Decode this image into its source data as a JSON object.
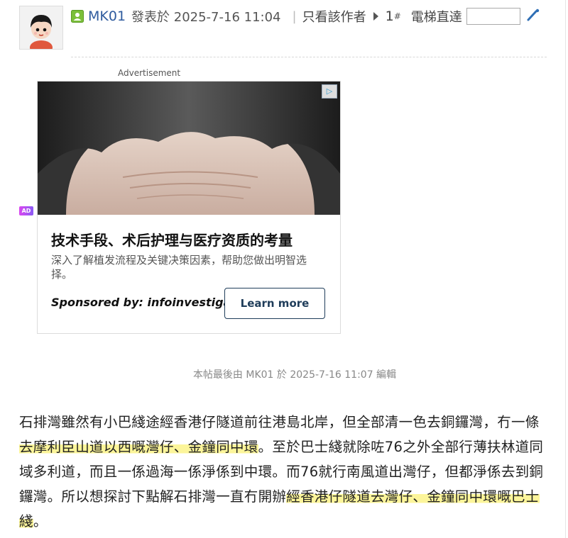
{
  "post": {
    "author": "MK01",
    "posted_text": "發表於 2025-7-16 11:04",
    "only_author_label": "只看該作者",
    "floor_number": "1",
    "floor_suffix": "#",
    "jump_label": "電梯直達",
    "jump_placeholder": ""
  },
  "ad": {
    "label": "Advertisement",
    "badge": "AD",
    "title": "技术手段、术后护理与医疗资质的考量",
    "description": "深入了解植发流程及关键决策因素，帮助您做出明智选择。",
    "sponsor": "Sponsored by: infoinvestigator",
    "cta": "Learn more"
  },
  "edit_note": "本帖最後由 MK01 於 2025-7-16 11:07 編輯",
  "body": {
    "p1": "石排灣雖然有小巴綫途經香港仔隧道前往港島北岸，但全部清一色去銅鑼灣，冇一條",
    "h1": "去摩利臣山道以西嘅灣仔、金鐘同中環",
    "p2": "。至於巴士綫就除咗76之外全部行薄扶林道同域多利道，而且一係過海一係淨係到中環。而76就行南風道出灣仔，但都淨係去到銅鑼灣。所以想探討下點解石排灣一直冇開辦",
    "h2": "經香港仔隧道去灣仔、金鐘同中環嘅巴士綫",
    "p3": "。"
  },
  "colors": {
    "author_link": "#2f5b9e",
    "highlight": "#fcf59a",
    "cta_border": "#1f3d5a"
  }
}
